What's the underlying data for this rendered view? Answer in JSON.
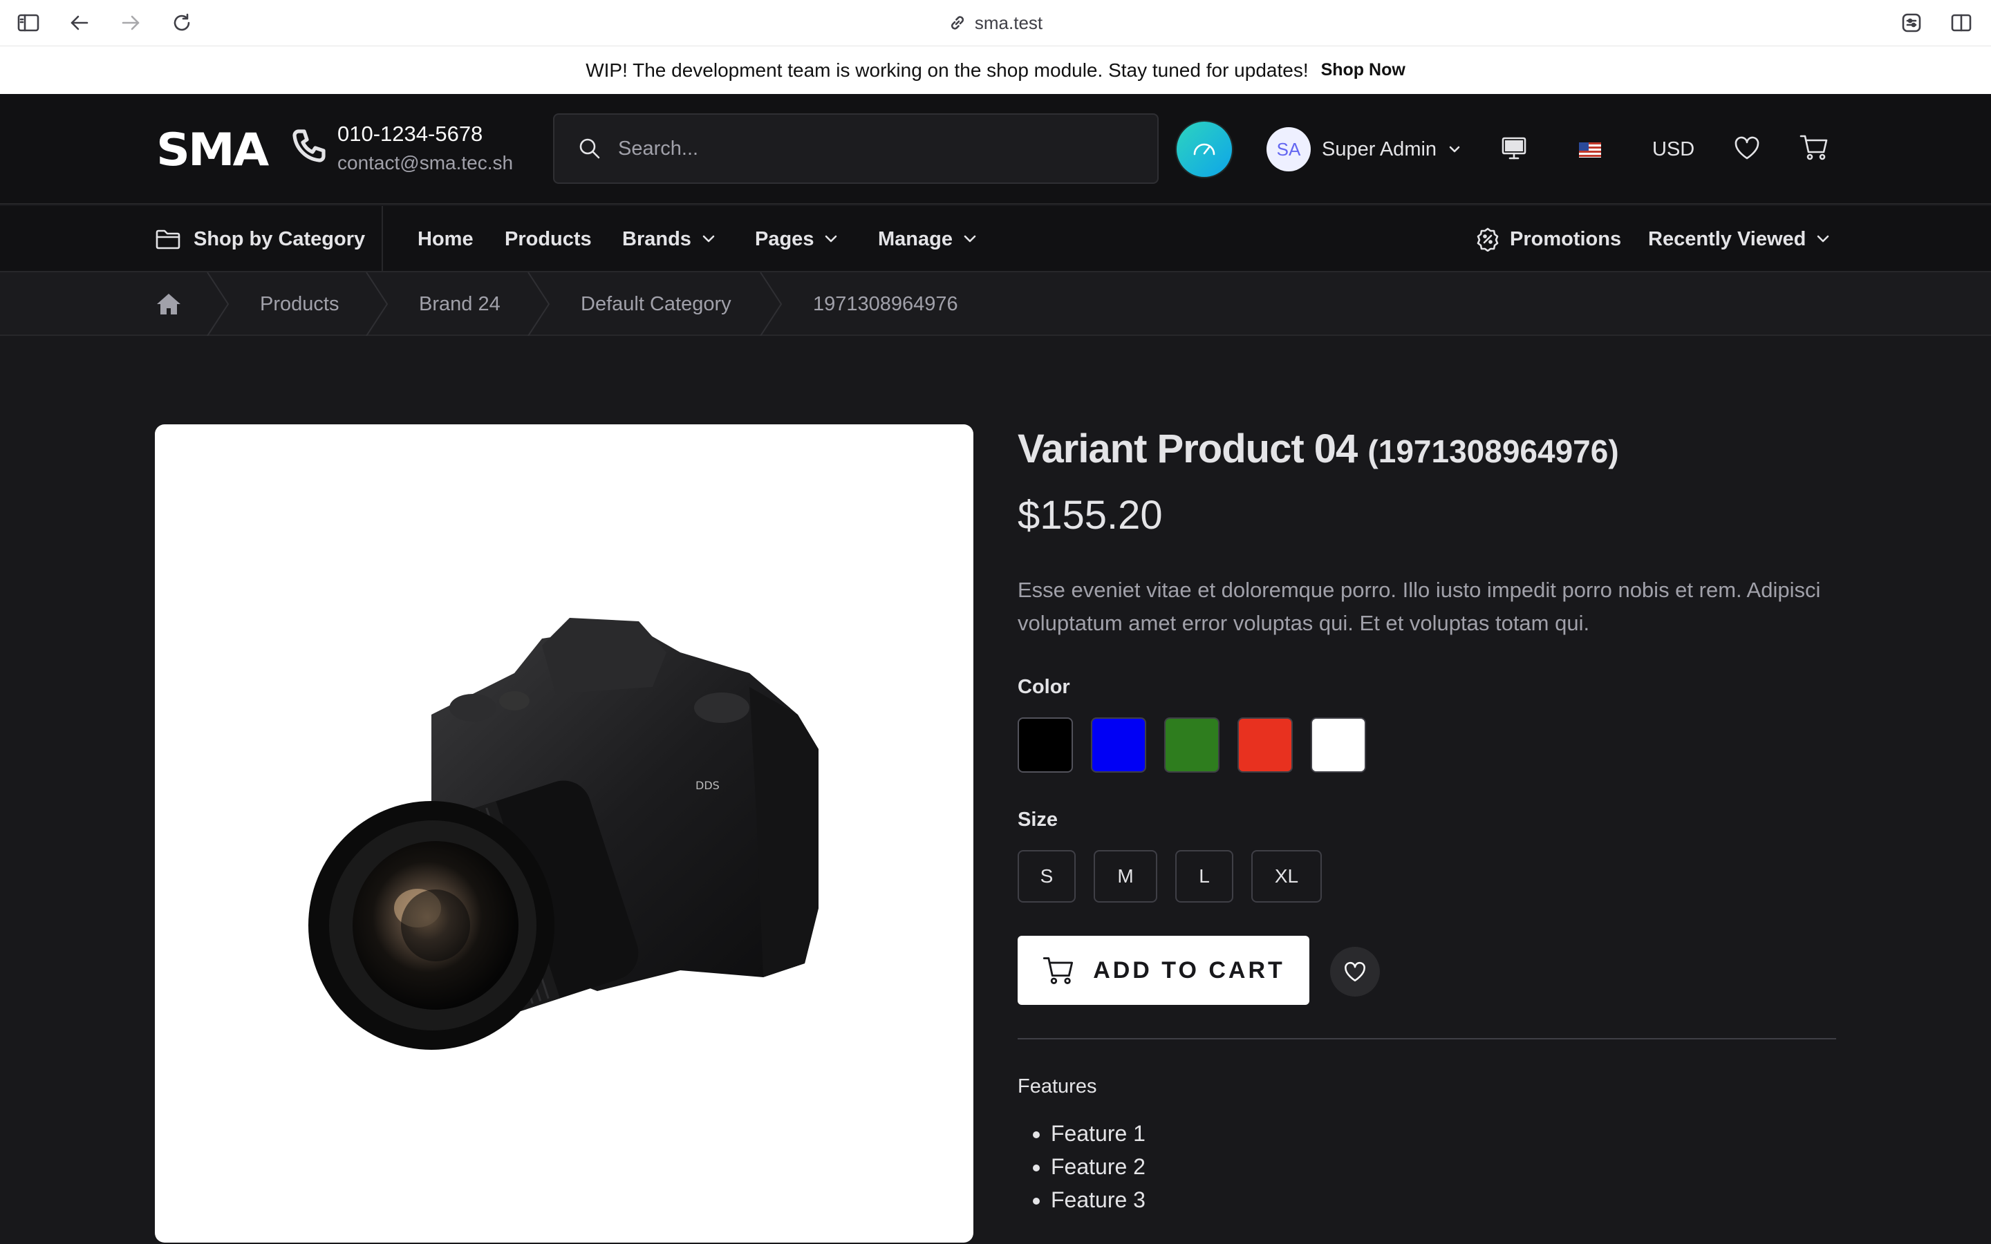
{
  "browser": {
    "url": "sma.test"
  },
  "announcement": {
    "text": "WIP! The development team is working on the shop module. Stay tuned for updates!",
    "link_label": "Shop Now"
  },
  "header": {
    "logo": "SMA",
    "phone": "010-1234-5678",
    "email": "contact@sma.tec.sh",
    "search_placeholder": "Search...",
    "user": {
      "initials": "SA",
      "name": "Super Admin"
    },
    "currency": "USD"
  },
  "nav": {
    "category_label": "Shop by Category",
    "items": [
      {
        "label": "Home"
      },
      {
        "label": "Products"
      },
      {
        "label": "Brands"
      },
      {
        "label": "Pages"
      },
      {
        "label": "Manage"
      }
    ],
    "promotions_label": "Promotions",
    "recent_label": "Recently Viewed"
  },
  "breadcrumb": [
    "Products",
    "Brand 24",
    "Default Category",
    "1971308964976"
  ],
  "product": {
    "name": "Variant Product 04",
    "code": "(1971308964976)",
    "price": "$155.20",
    "description": "Esse eveniet vitae et doloremque porro. Illo iusto impedit porro nobis et rem. Adipisci voluptatum amet error voluptas qui. Et et voluptas totam qui.",
    "color_label": "Color",
    "colors": [
      "#000000",
      "#0000f5",
      "#2e7d1e",
      "#e8311f",
      "#ffffff"
    ],
    "size_label": "Size",
    "sizes": [
      "S",
      "M",
      "L",
      "XL"
    ],
    "add_to_cart": "ADD TO CART",
    "features_label": "Features",
    "features": [
      "Feature 1",
      "Feature 2",
      "Feature 3"
    ]
  }
}
